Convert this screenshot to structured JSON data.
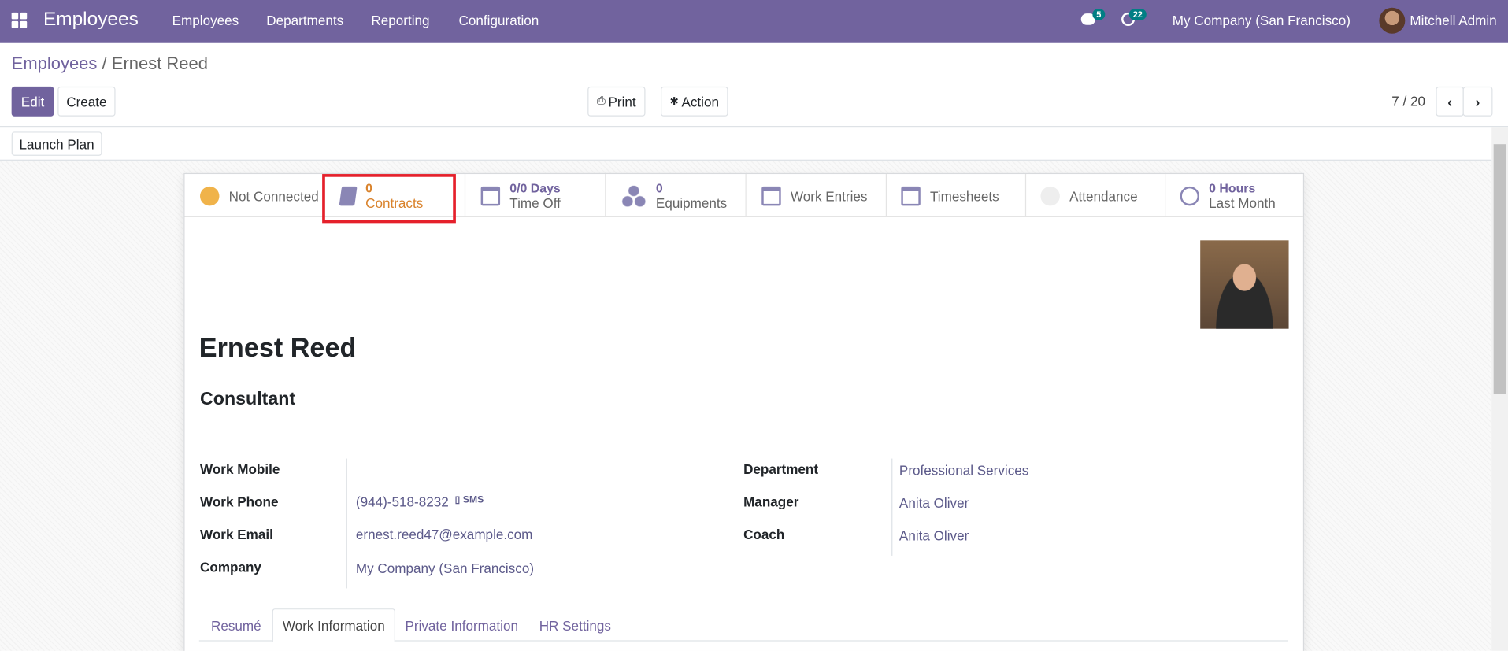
{
  "navbar": {
    "app_title": "Employees",
    "menu": [
      "Employees",
      "Departments",
      "Reporting",
      "Configuration"
    ],
    "messages_count": "5",
    "activities_count": "22",
    "company": "My Company (San Francisco)",
    "user": "Mitchell Admin"
  },
  "breadcrumb": {
    "parent": "Employees",
    "separator": "/",
    "current": "Ernest Reed"
  },
  "toolbar": {
    "edit": "Edit",
    "create": "Create",
    "print": "Print",
    "action": "Action",
    "pager": "7 / 20"
  },
  "statusbar": {
    "launch_plan": "Launch Plan"
  },
  "button_box": [
    {
      "value": "",
      "label": "Not Connected"
    },
    {
      "value": "0",
      "label": "Contracts"
    },
    {
      "value": "0/0 Days",
      "label": "Time Off"
    },
    {
      "value": "0",
      "label": "Equipments"
    },
    {
      "value": "",
      "label": "Work Entries"
    },
    {
      "value": "",
      "label": "Timesheets"
    },
    {
      "value": "",
      "label": "Attendance"
    },
    {
      "value": "0 Hours",
      "label": "Last Month"
    }
  ],
  "employee": {
    "name": "Ernest Reed",
    "job_title": "Consultant"
  },
  "fields_left": [
    {
      "label": "Work Mobile",
      "value": ""
    },
    {
      "label": "Work Phone",
      "value": "(944)-518-8232",
      "extra": "SMS"
    },
    {
      "label": "Work Email",
      "value": "ernest.reed47@example.com"
    },
    {
      "label": "Company",
      "value": "My Company (San Francisco)"
    }
  ],
  "fields_right": [
    {
      "label": "Department",
      "value": "Professional Services"
    },
    {
      "label": "Manager",
      "value": "Anita Oliver"
    },
    {
      "label": "Coach",
      "value": "Anita Oliver"
    }
  ],
  "tabs": [
    "Resumé",
    "Work Information",
    "Private Information",
    "HR Settings"
  ],
  "active_tab": "Work Information",
  "colors": {
    "brand": "#71639e",
    "highlight": "#e5202b",
    "accent": "#d9822b"
  }
}
